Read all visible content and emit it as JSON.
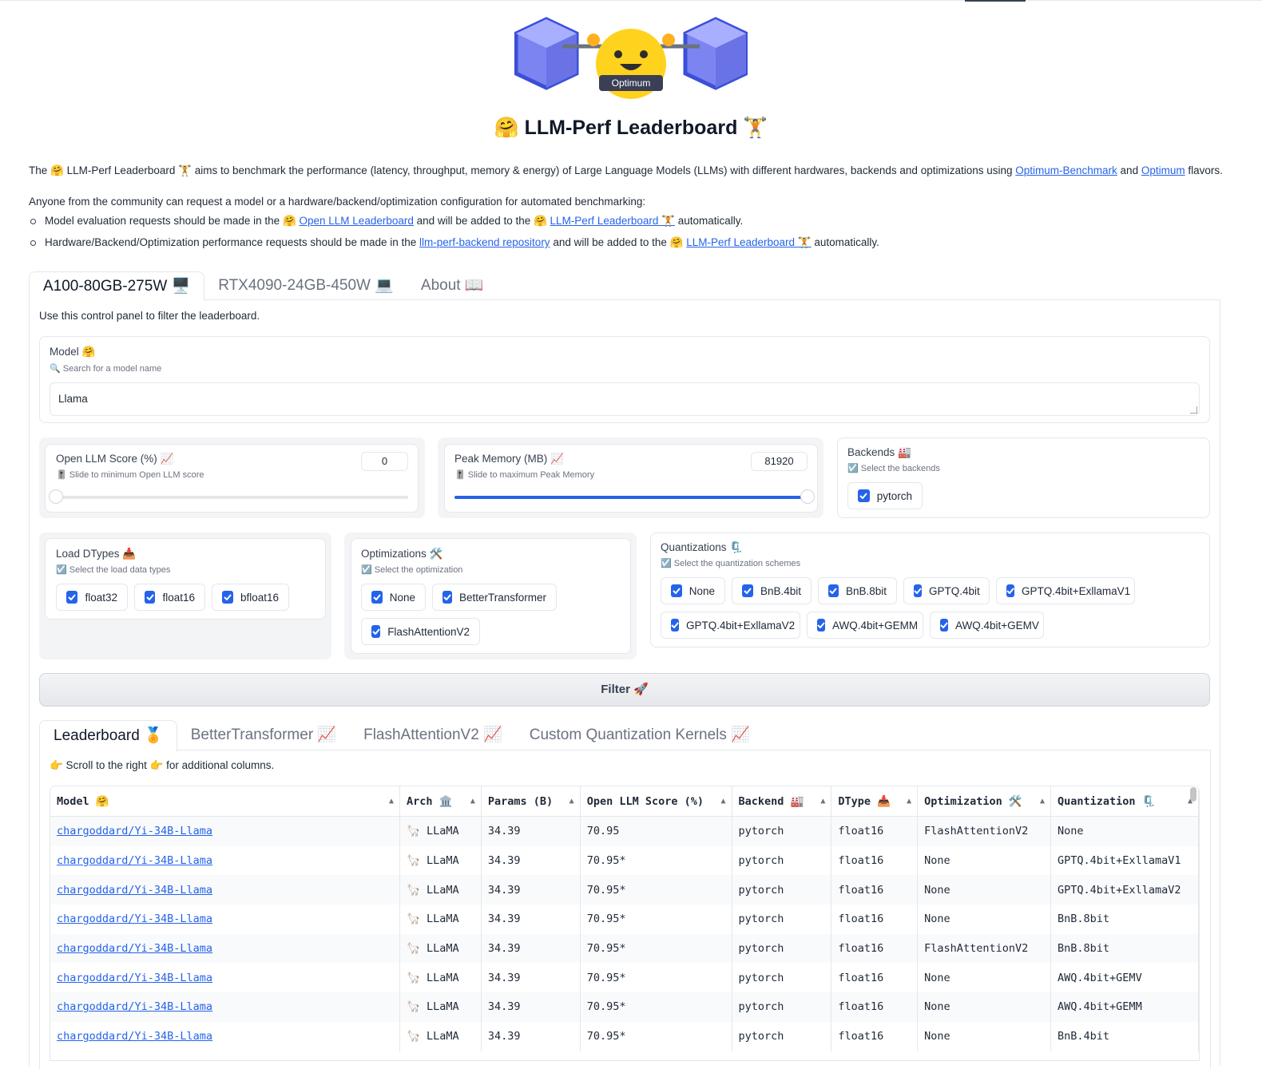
{
  "header": {
    "logo_badge": "Optimum",
    "title": "🤗 LLM-Perf Leaderboard 🏋️",
    "intro": {
      "part1": "The 🤗 LLM-Perf Leaderboard 🏋️ aims to benchmark the performance (latency, throughput, memory & energy) of Large Language Models (LLMs) with different hardwares, backends and optimizations using ",
      "link1": "Optimum-Benchmark",
      "part2": " and ",
      "link2": "Optimum",
      "part3": " flavors."
    },
    "request_text": "Anyone from the community can request a model or a hardware/backend/optimization configuration for automated benchmarking:",
    "bullets": [
      {
        "t1": "Model evaluation requests should be made in the 🤗 ",
        "l1": "Open LLM Leaderboard",
        "t2": " and will be added to the 🤗 ",
        "l2": "LLM-Perf Leaderboard 🏋️",
        "t3": " automatically."
      },
      {
        "t1": "Hardware/Backend/Optimization performance requests should be made in the ",
        "l1": "llm-perf-backend repository",
        "t2": " and will be added to the 🤗 ",
        "l2": "LLM-Perf Leaderboard 🏋️",
        "t3": " automatically."
      }
    ]
  },
  "hardware_tabs": [
    "A100-80GB-275W 🖥️",
    "RTX4090-24GB-450W 💻",
    "About 📖"
  ],
  "control_hint": "Use this control panel to filter the leaderboard.",
  "model_filter": {
    "label": "Model 🤗",
    "info": "🔍 Search for a model name",
    "value": "Llama"
  },
  "score_slider": {
    "label": "Open LLM Score (%) 📈",
    "info": "🎚️ Slide to minimum Open LLM score",
    "value": "0",
    "fraction": 0
  },
  "memory_slider": {
    "label": "Peak Memory (MB) 📈",
    "info": "🎚️ Slide to maximum Peak Memory",
    "value": "81920",
    "fraction": 1
  },
  "backends": {
    "label": "Backends 🏭",
    "info": "☑️ Select the backends",
    "options": [
      "pytorch"
    ]
  },
  "dtypes": {
    "label": "Load DTypes 📥",
    "info": "☑️ Select the load data types",
    "options": [
      "float32",
      "float16",
      "bfloat16"
    ]
  },
  "optimizations": {
    "label": "Optimizations 🛠️",
    "info": "☑️ Select the optimization",
    "options": [
      "None",
      "BetterTransformer",
      "FlashAttentionV2"
    ]
  },
  "quantizations": {
    "label": "Quantizations 🗜️",
    "info": "☑️ Select the quantization schemes",
    "options": [
      "None",
      "BnB.4bit",
      "BnB.8bit",
      "GPTQ.4bit",
      "GPTQ.4bit+ExllamaV1",
      "GPTQ.4bit+ExllamaV2",
      "AWQ.4bit+GEMM",
      "AWQ.4bit+GEMV"
    ]
  },
  "filter_button": "Filter 🚀",
  "result_tabs": [
    "Leaderboard 🏅",
    "BetterTransformer 📈",
    "FlashAttentionV2 📈",
    "Custom Quantization Kernels 📈"
  ],
  "scroll_hint": "👉 Scroll to the right 👉 for additional columns.",
  "sort_icon": "▲",
  "table": {
    "columns": [
      "Model 🤗",
      "Arch 🏛️",
      "Params (B)",
      "Open LLM Score (%)",
      "Backend 🏭",
      "DType 📥",
      "Optimization 🛠️",
      "Quantization 🗜️"
    ],
    "rows": [
      [
        "chargoddard/Yi-34B-Llama",
        "🦙 LLaMA",
        "34.39",
        "70.95",
        "pytorch",
        "float16",
        "FlashAttentionV2",
        "None"
      ],
      [
        "chargoddard/Yi-34B-Llama",
        "🦙 LLaMA",
        "34.39",
        "70.95*",
        "pytorch",
        "float16",
        "None",
        "GPTQ.4bit+ExllamaV1"
      ],
      [
        "chargoddard/Yi-34B-Llama",
        "🦙 LLaMA",
        "34.39",
        "70.95*",
        "pytorch",
        "float16",
        "None",
        "GPTQ.4bit+ExllamaV2"
      ],
      [
        "chargoddard/Yi-34B-Llama",
        "🦙 LLaMA",
        "34.39",
        "70.95*",
        "pytorch",
        "float16",
        "None",
        "BnB.8bit"
      ],
      [
        "chargoddard/Yi-34B-Llama",
        "🦙 LLaMA",
        "34.39",
        "70.95*",
        "pytorch",
        "float16",
        "FlashAttentionV2",
        "BnB.8bit"
      ],
      [
        "chargoddard/Yi-34B-Llama",
        "🦙 LLaMA",
        "34.39",
        "70.95*",
        "pytorch",
        "float16",
        "None",
        "AWQ.4bit+GEMV"
      ],
      [
        "chargoddard/Yi-34B-Llama",
        "🦙 LLaMA",
        "34.39",
        "70.95*",
        "pytorch",
        "float16",
        "None",
        "AWQ.4bit+GEMM"
      ],
      [
        "chargoddard/Yi-34B-Llama",
        "🦙 LLaMA",
        "34.39",
        "70.95*",
        "pytorch",
        "float16",
        "None",
        "BnB.4bit"
      ]
    ]
  },
  "colors": {
    "accent": "#2563eb",
    "border": "#e5e7eb"
  }
}
